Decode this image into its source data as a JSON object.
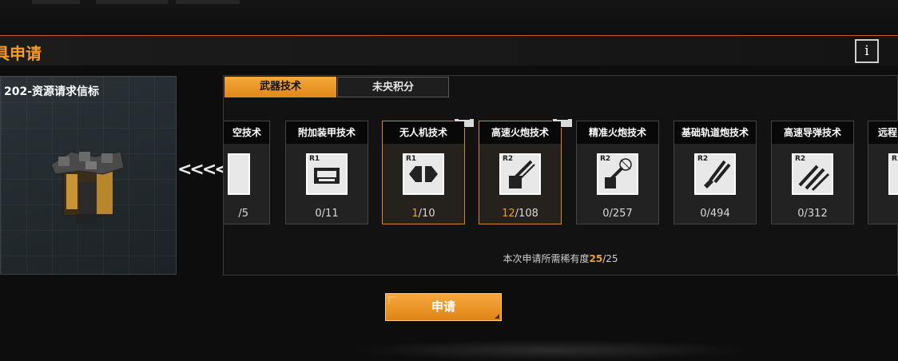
{
  "header": {
    "title": "具申请",
    "info_label": "i"
  },
  "item": {
    "name": "202-资源请求信标"
  },
  "tabs": [
    {
      "label": "武器技术",
      "active": true
    },
    {
      "label": "未央积分",
      "active": false
    }
  ],
  "cards": [
    {
      "name": "空技术",
      "rank": "",
      "owned": "",
      "total": "/5",
      "selected": false,
      "icon": "partial-icon"
    },
    {
      "name": "附加装甲技术",
      "rank": "R1",
      "owned": "0",
      "total": "/11",
      "selected": false,
      "icon": "armor-plate-icon"
    },
    {
      "name": "无人机技术",
      "rank": "R1",
      "owned": "1",
      "total": "/10",
      "selected": true,
      "icon": "drone-icon"
    },
    {
      "name": "高速火炮技术",
      "rank": "R2",
      "owned": "12",
      "total": "/108",
      "selected": true,
      "icon": "cannon-icon"
    },
    {
      "name": "精准火炮技术",
      "rank": "R2",
      "owned": "0",
      "total": "/257",
      "selected": false,
      "icon": "precision-cannon-icon"
    },
    {
      "name": "基础轨道炮技术",
      "rank": "R2",
      "owned": "0",
      "total": "/494",
      "selected": false,
      "icon": "railgun-icon"
    },
    {
      "name": "高速导弹技术",
      "rank": "R2",
      "owned": "0",
      "total": "/312",
      "selected": false,
      "icon": "missile-icon"
    },
    {
      "name": "远程",
      "rank": "R",
      "owned": "",
      "total": "",
      "selected": false,
      "icon": "partial-icon"
    }
  ],
  "requirement": {
    "prefix": "本次申请所需稀有度",
    "current": "25",
    "max": "/25"
  },
  "apply_label": "申请",
  "colors": {
    "accent": "#f0a028",
    "tab_active": "#e08718"
  }
}
